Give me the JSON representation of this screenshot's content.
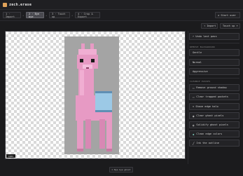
{
  "app": {
    "title": "zech.erase"
  },
  "steps": [
    {
      "label": "1 · Import"
    },
    {
      "label": "2 · Bye bye"
    },
    {
      "label": "3 · Touch up"
    },
    {
      "label": "4 · Crop & Export"
    }
  ],
  "toolbar": {
    "start_over": "↺ Start over",
    "import": "↑ Import",
    "touchup": "Touch up ▾"
  },
  "canvas": {
    "zoom": "100%"
  },
  "ghost_button": "⊙ Bye bye ghost",
  "panel": {
    "undo": "↶ Undo last pass",
    "bg_section": "REMOVE BACKGROUND",
    "modes": [
      "Gentle",
      "Normal",
      "Aggressive"
    ],
    "cleanup_section": "CLEANUP PASSES",
    "remove_shadow": "Remove ground shadow",
    "clear_pockets": "Clear trapped pockets",
    "shave": "≈ Shave edge halo",
    "tools": [
      {
        "icon": "ghost-icon",
        "glyph": "◉",
        "label": "Clear ghost pixels"
      },
      {
        "icon": "solidify-icon",
        "glyph": "◍",
        "label": "Solidify ghost pixels"
      },
      {
        "icon": "palette-icon",
        "glyph": "◆",
        "label": "Clean edge colors"
      },
      {
        "icon": "pen-icon",
        "glyph": "╱",
        "label": "Ink the outline"
      }
    ]
  },
  "colors": {
    "accent": "#e0a25a",
    "llama": "#e79ac4",
    "blanket": "#9cc9e6"
  }
}
